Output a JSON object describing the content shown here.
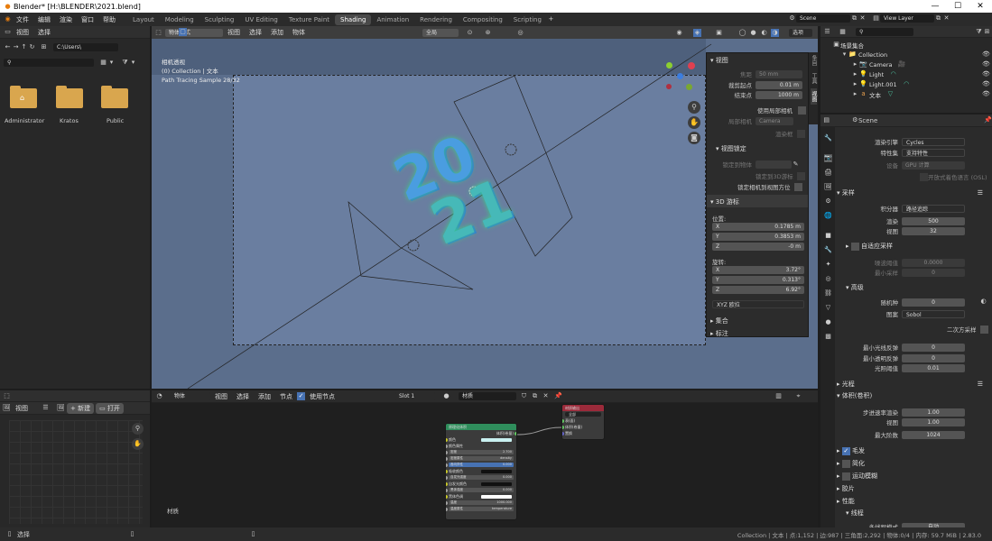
{
  "window": {
    "title": "Blender* [H:\\BLENDER\\2021.blend]"
  },
  "menu": [
    "文件",
    "编辑",
    "渲染",
    "窗口",
    "帮助"
  ],
  "workspaces": [
    "Layout",
    "Modeling",
    "Sculpting",
    "UV Editing",
    "Texture Paint",
    "Shading",
    "Animation",
    "Rendering",
    "Compositing",
    "Scripting"
  ],
  "active_workspace": "Shading",
  "scene_name": "Scene",
  "view_layer": "View Layer",
  "file_browser": {
    "menus": [
      "视图",
      "选择"
    ],
    "path": "C:\\Users\\",
    "folders": [
      "Administrator",
      "Kratos",
      "Public"
    ]
  },
  "viewport": {
    "mode": "物体模式",
    "menus": [
      "视图",
      "选择",
      "添加",
      "物体"
    ],
    "transform_orientation": "全局",
    "options": "选项",
    "overlay_text": [
      "相机透视",
      "(0) Collection | 文本",
      "Path Tracing Sample 28/32"
    ],
    "text_3d": [
      "20",
      "21"
    ]
  },
  "npanel": {
    "view_header": "视图",
    "focal_label": "焦距",
    "focal_value": "50 mm",
    "clip_start_label": "裁剪起点",
    "clip_start": "0.01 m",
    "clip_end_label": "结束点",
    "clip_end": "1000 m",
    "local_camera_label": "使用局部相机",
    "local_camera_field_label": "局部相机",
    "local_camera_value": "Camera",
    "render_region_label": "渲染框",
    "view_lock_header": "视图锁定",
    "lock_object_label": "锁定到物体",
    "lock_3d_cursor_label": "锁定到3D游标",
    "lock_camera_label": "锁定相机到视图方位",
    "cursor_header": "3D 游标",
    "location_label": "位置:",
    "loc": [
      {
        "axis": "X",
        "value": "0.1785 m"
      },
      {
        "axis": "Y",
        "value": "0.3853 m"
      },
      {
        "axis": "Z",
        "value": "-0 m"
      }
    ],
    "rotation_label": "旋转:",
    "rot": [
      {
        "axis": "X",
        "value": "3.72°"
      },
      {
        "axis": "Y",
        "value": "0.313°"
      },
      {
        "axis": "Z",
        "value": "6.92°"
      }
    ],
    "rotation_mode": "XYZ 欧拉",
    "collection_header": "集合",
    "annotation_header": "标注",
    "tabs": [
      "条目",
      "工具",
      "视图"
    ]
  },
  "outliner": {
    "search_placeholder": "",
    "root": "场景集合",
    "items": [
      {
        "name": "Collection",
        "indent": 0
      },
      {
        "name": "Camera",
        "indent": 1
      },
      {
        "name": "Light",
        "indent": 1
      },
      {
        "name": "Light.001",
        "indent": 1
      },
      {
        "name": "文本",
        "indent": 1
      }
    ]
  },
  "properties": {
    "context": "Scene",
    "render_engine_label": "渲染引擎",
    "render_engine": "Cycles",
    "feature_set_label": "特性集",
    "feature_set": "支持特性",
    "device_label": "设备",
    "device": "GPU 计算",
    "osl_label": "开放式着色语言 (OSL)",
    "sampling_header": "采样",
    "integrator_label": "积分器",
    "integrator": "路径追踪",
    "render_samples_label": "渲染",
    "render_samples": "500",
    "viewport_samples_label": "视图",
    "viewport_samples": "32",
    "adaptive_label": "自适应采样",
    "noise_threshold_label": "噪波阈值",
    "noise_threshold": "0.0000",
    "min_samples_label": "最小采样",
    "min_samples": "0",
    "advanced_header": "高级",
    "seed_label": "随机种",
    "seed": "0",
    "pattern_label": "图案",
    "pattern": "Sobol",
    "square_samples_label": "二次方采样",
    "min_light_bounces_label": "最小光线反弹",
    "min_light_bounces": "0",
    "min_transparent_bounces_label": "最小透明反弹",
    "min_transparent_bounces": "0",
    "light_threshold_label": "光照阈值",
    "light_threshold": "0.01",
    "light_paths_header": "光程",
    "volumes_header": "体积(卷积)",
    "step_rate_render_label": "步进速率渲染",
    "step_rate_render": "1.00",
    "step_rate_viewport_label": "视图",
    "step_rate_viewport": "1.00",
    "max_steps_label": "最大阶数",
    "max_steps": "1024",
    "hair_label": "毛发",
    "simplify_label": "简化",
    "motion_blur_label": "运动模糊",
    "film_label": "胶片",
    "performance_label": "性能",
    "threads_label": "线程",
    "tiles_label": "多线程模式",
    "tiles_value": "自动"
  },
  "image_editor": {
    "menus": [
      "视图"
    ],
    "new_label": "新建",
    "open_label": "打开"
  },
  "node_editor": {
    "type": "物体",
    "menus": [
      "视图",
      "选择",
      "添加",
      "节点"
    ],
    "use_nodes_label": "使用节点",
    "slot": "Slot 1",
    "material": "材质",
    "frame_label": "材质",
    "principled_volume": {
      "title": "原理化体积",
      "output": "体积(卷量)",
      "rows": [
        "颜色",
        "颜色属性",
        "密度",
        "密度属性",
        "各向异性",
        "吸收颜色",
        "自发光强度",
        "自发光颜色",
        "黑体强度",
        "黑体色调",
        "温度",
        "温度属性"
      ],
      "values": {
        "density": "2.700",
        "density_attr": "density",
        "anisotropy": "0.000",
        "emission_strength": "0.000",
        "blackbody": "0.000",
        "temperature": "1000.000",
        "temp_attr": "temperature"
      }
    },
    "output_node": {
      "title": "材质输出",
      "target": "全部",
      "sockets": [
        "表(面)",
        "体积(卷量)",
        "置换"
      ]
    }
  },
  "status": {
    "left": "选择",
    "right": "Collection | 文本 | 点:1,152 | 边:987 | 三角面:2,292 | 物体:0/4 | 内存: 59.7 MiB | 2.83.0"
  }
}
